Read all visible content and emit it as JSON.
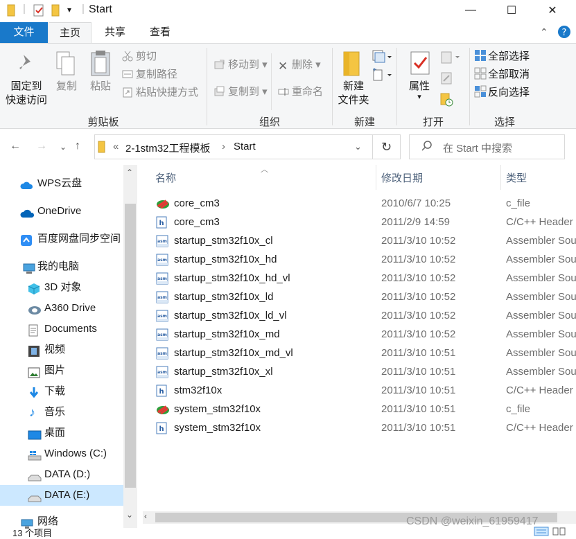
{
  "window": {
    "title": "Start",
    "controls": {
      "minimize": "—",
      "maximize": "☐",
      "close": "✕"
    }
  },
  "ribbon_tabs": [
    {
      "label": "文件"
    },
    {
      "label": "主页"
    },
    {
      "label": "共享"
    },
    {
      "label": "查看"
    }
  ],
  "ribbon": {
    "clipboard": {
      "pin_line1": "固定到",
      "pin_line2": "快速访问",
      "copy": "复制",
      "paste": "粘贴",
      "cut": "剪切",
      "copy_path": "复制路径",
      "paste_shortcut": "粘贴快捷方式",
      "group": "剪贴板"
    },
    "organize": {
      "move_to": "移动到",
      "copy_to": "复制到",
      "delete": "删除",
      "rename": "重命名",
      "group": "组织"
    },
    "new": {
      "new_folder_line1": "新建",
      "new_folder_line2": "文件夹",
      "group": "新建"
    },
    "open": {
      "properties": "属性",
      "group": "打开"
    },
    "select": {
      "select_all": "全部选择",
      "select_none": "全部取消",
      "invert": "反向选择",
      "group": "选择"
    }
  },
  "address": {
    "overflow": "«",
    "crumbs": [
      "2-1stm32工程模板",
      "Start"
    ],
    "search_placeholder": "在 Start 中搜索"
  },
  "nav": [
    {
      "label": "WPS云盘"
    },
    {
      "label": "OneDrive"
    },
    {
      "label": "百度网盘同步空间"
    },
    {
      "label": "我的电脑"
    },
    {
      "label": "3D 对象"
    },
    {
      "label": "A360 Drive"
    },
    {
      "label": "Documents"
    },
    {
      "label": "视频"
    },
    {
      "label": "图片"
    },
    {
      "label": "下载"
    },
    {
      "label": "音乐"
    },
    {
      "label": "桌面"
    },
    {
      "label": "Windows (C:)"
    },
    {
      "label": "DATA (D:)"
    },
    {
      "label": "DATA (E:)"
    },
    {
      "label": "网络"
    }
  ],
  "columns": {
    "name": "名称",
    "date": "修改日期",
    "type": "类型"
  },
  "files": [
    {
      "name": "core_cm3",
      "date": "2010/6/7 10:25",
      "type": "c_file",
      "icon": "c-file-icon"
    },
    {
      "name": "core_cm3",
      "date": "2011/2/9 14:59",
      "type": "C/C++ Header",
      "icon": "h-file-icon"
    },
    {
      "name": "startup_stm32f10x_cl",
      "date": "2011/3/10 10:52",
      "type": "Assembler Source",
      "icon": "asm-file-icon"
    },
    {
      "name": "startup_stm32f10x_hd",
      "date": "2011/3/10 10:52",
      "type": "Assembler Source",
      "icon": "asm-file-icon"
    },
    {
      "name": "startup_stm32f10x_hd_vl",
      "date": "2011/3/10 10:52",
      "type": "Assembler Source",
      "icon": "asm-file-icon"
    },
    {
      "name": "startup_stm32f10x_ld",
      "date": "2011/3/10 10:52",
      "type": "Assembler Source",
      "icon": "asm-file-icon"
    },
    {
      "name": "startup_stm32f10x_ld_vl",
      "date": "2011/3/10 10:52",
      "type": "Assembler Source",
      "icon": "asm-file-icon"
    },
    {
      "name": "startup_stm32f10x_md",
      "date": "2011/3/10 10:52",
      "type": "Assembler Source",
      "icon": "asm-file-icon"
    },
    {
      "name": "startup_stm32f10x_md_vl",
      "date": "2011/3/10 10:51",
      "type": "Assembler Source",
      "icon": "asm-file-icon"
    },
    {
      "name": "startup_stm32f10x_xl",
      "date": "2011/3/10 10:51",
      "type": "Assembler Source",
      "icon": "asm-file-icon"
    },
    {
      "name": "stm32f10x",
      "date": "2011/3/10 10:51",
      "type": "C/C++ Header",
      "icon": "h-file-icon"
    },
    {
      "name": "system_stm32f10x",
      "date": "2011/3/10 10:51",
      "type": "c_file",
      "icon": "c-file-icon"
    },
    {
      "name": "system_stm32f10x",
      "date": "2011/3/10 10:51",
      "type": "C/C++ Header",
      "icon": "h-file-icon"
    }
  ],
  "status": {
    "count": "13 个项目"
  },
  "watermark": "CSDN @weixin_61959417",
  "colors": {
    "accent": "#1979ca",
    "selected": "#cce8ff",
    "folder": "#f4c542"
  }
}
